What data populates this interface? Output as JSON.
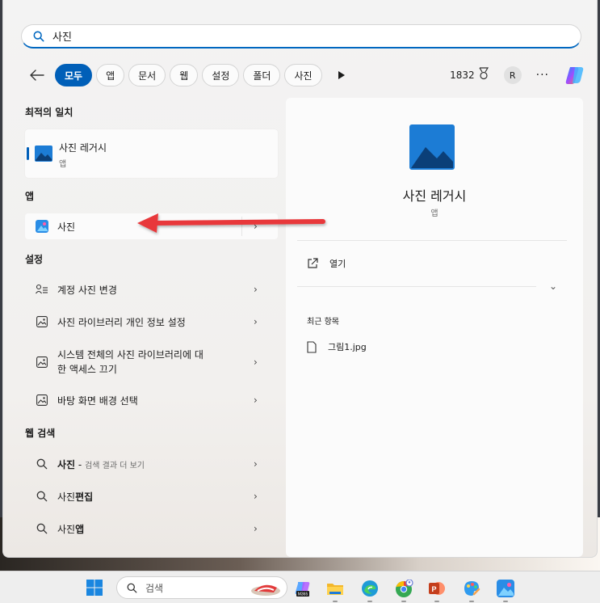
{
  "search": {
    "query": "사진"
  },
  "filters": {
    "chips": [
      "모두",
      "앱",
      "문서",
      "웹",
      "설정",
      "폴더",
      "사진"
    ],
    "points": "1832",
    "avatar_initial": "R",
    "more": "···"
  },
  "best_match": {
    "title": "최적의 일치",
    "name": "사진 레거시",
    "type": "앱"
  },
  "apps": {
    "title": "앱",
    "items": [
      {
        "label": "사진"
      }
    ]
  },
  "settings": {
    "title": "설정",
    "items": [
      {
        "label": "계정 사진 변경"
      },
      {
        "label": "사진 라이브러리 개인 정보 설정"
      },
      {
        "label_line1": "시스템 전체의 사진 라이브러리에 대",
        "label_line2": "한 액세스 끄기"
      },
      {
        "label": "바탕 화면 배경 선택"
      }
    ]
  },
  "web": {
    "title": "웹 검색",
    "items": [
      {
        "bold": "사진",
        "rest": " - ",
        "meta": "검색 결과 더 보기"
      },
      {
        "plain": "사진",
        "bold": "편집"
      },
      {
        "plain": "사진",
        "bold": "앱"
      }
    ]
  },
  "preview": {
    "name": "사진 레거시",
    "type": "앱",
    "open_label": "열기",
    "recent_title": "최근 항목",
    "recent_files": [
      "그림1.jpg"
    ]
  },
  "taskbar": {
    "search_placeholder": "검색",
    "m365_label": "M365"
  },
  "colors": {
    "accent": "#005fb8",
    "arrow": "#e8373a"
  }
}
